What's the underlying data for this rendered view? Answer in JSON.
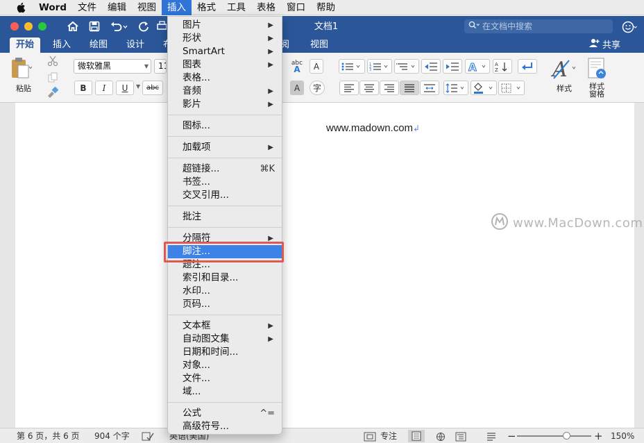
{
  "menubar": {
    "app": "Word",
    "items": [
      "文件",
      "编辑",
      "视图",
      "插入",
      "格式",
      "工具",
      "表格",
      "窗口",
      "帮助"
    ],
    "active": "插入"
  },
  "window": {
    "title": "文档1",
    "search_placeholder": "在文档中搜索"
  },
  "ribbon": {
    "tabs": [
      "开始",
      "插入",
      "绘图",
      "设计",
      "布",
      "阅",
      "视图"
    ],
    "active_tab": "开始",
    "share": "共享",
    "paste": "粘贴",
    "font": "微软雅黑",
    "font_size": "11",
    "bold": "B",
    "italic": "I",
    "underline": "U",
    "strike": "abc",
    "abc_a": "abc",
    "styles": "样式",
    "styles_pane": "样式\n窗格",
    "styles_pane_l1": "样式",
    "styles_pane_l2": "窗格",
    "char_a": "A",
    "char_zi": "字"
  },
  "document": {
    "text": "www.madown.com",
    "watermark": "www.MacDown.com"
  },
  "insert_menu": {
    "groups": [
      [
        {
          "label": "图片",
          "submenu": true
        },
        {
          "label": "形状",
          "submenu": true
        },
        {
          "label": "SmartArt",
          "submenu": true
        },
        {
          "label": "图表",
          "submenu": true
        },
        {
          "label": "表格...",
          "submenu": false
        },
        {
          "label": "音频",
          "submenu": true
        },
        {
          "label": "影片",
          "submenu": true
        }
      ],
      [
        {
          "label": "图标...",
          "submenu": false
        }
      ],
      [
        {
          "label": "加载项",
          "submenu": true
        }
      ],
      [
        {
          "label": "超链接...",
          "shortcut": "⌘K"
        },
        {
          "label": "书签..."
        },
        {
          "label": "交叉引用..."
        }
      ],
      [
        {
          "label": "批注"
        }
      ],
      [
        {
          "label": "分隔符",
          "submenu": true
        },
        {
          "label": "脚注...",
          "highlighted": true
        },
        {
          "label": "题注..."
        },
        {
          "label": "索引和目录..."
        },
        {
          "label": "水印..."
        },
        {
          "label": "页码..."
        }
      ],
      [
        {
          "label": "文本框",
          "submenu": true
        },
        {
          "label": "自动图文集",
          "submenu": true
        },
        {
          "label": "日期和时间..."
        },
        {
          "label": "对象..."
        },
        {
          "label": "文件..."
        },
        {
          "label": "域..."
        }
      ],
      [
        {
          "label": "公式",
          "shortcut": "^="
        },
        {
          "label": "高级符号..."
        }
      ]
    ]
  },
  "statusbar": {
    "page": "第 6 页，共 6 页",
    "words": "904 个字",
    "language": "英语(美国)",
    "focus": "专注",
    "zoom": "150%",
    "zoom_fraction": 0.66
  },
  "colors": {
    "word_blue": "#2b579a",
    "highlight": "#3d82e6",
    "annotation_red": "#e0584f"
  }
}
